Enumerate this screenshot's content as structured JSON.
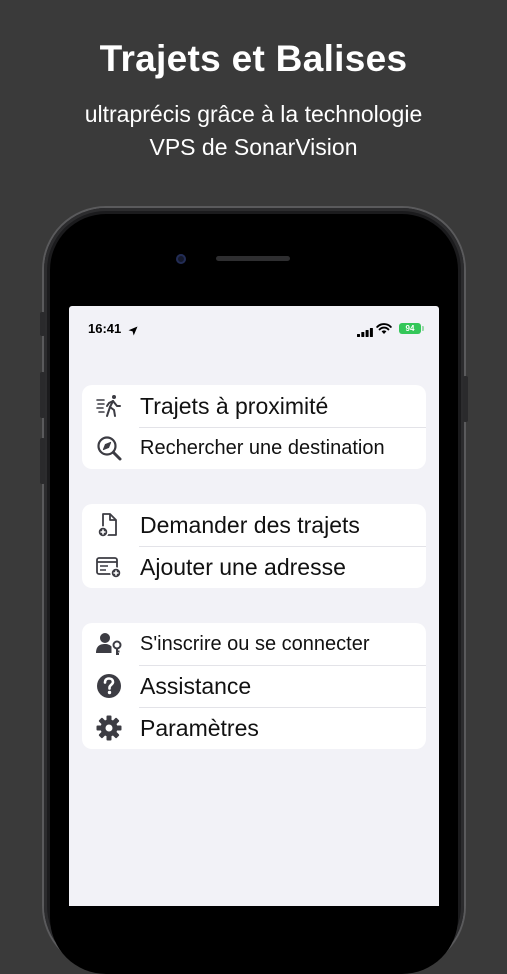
{
  "promo": {
    "title": "Trajets et Balises",
    "subtitle_line1": "ultraprécis grâce à la technologie",
    "subtitle_line2": "VPS de SonarVision"
  },
  "status_bar": {
    "time": "16:41",
    "battery": "94",
    "icons": [
      "location-arrow-icon",
      "signal-icon",
      "wifi-icon",
      "battery-icon"
    ]
  },
  "menu": {
    "groups": [
      {
        "items": [
          {
            "label": "Trajets à proximité",
            "icon": "walking-person-icon"
          },
          {
            "label": "Rechercher une destination",
            "icon": "search-compass-icon"
          }
        ]
      },
      {
        "items": [
          {
            "label": "Demander des trajets",
            "icon": "add-document-icon"
          },
          {
            "label": "Ajouter une adresse",
            "icon": "add-address-icon"
          }
        ]
      },
      {
        "items": [
          {
            "label": "S'inscrire ou se connecter",
            "icon": "user-key-icon"
          },
          {
            "label": "Assistance",
            "icon": "help-icon"
          },
          {
            "label": "Paramètres",
            "icon": "gear-icon"
          }
        ]
      }
    ]
  },
  "colors": {
    "background": "#3a3a3a",
    "screen_background": "#f2f2f7",
    "battery_green": "#34c759",
    "icon_color": "#3c3c43"
  }
}
